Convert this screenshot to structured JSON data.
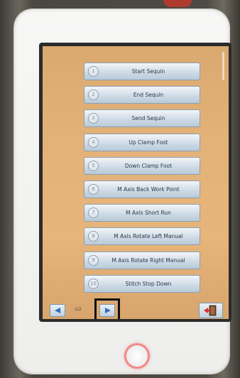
{
  "menu": {
    "items": [
      {
        "num": "1",
        "label": "Start Sequin"
      },
      {
        "num": "2",
        "label": "End Sequin"
      },
      {
        "num": "3",
        "label": "Send Sequin"
      },
      {
        "num": "4",
        "label": "Up Clamp Foot"
      },
      {
        "num": "5",
        "label": "Down Clamp Foot"
      },
      {
        "num": "6",
        "label": "M Axis Back Work Point"
      },
      {
        "num": "7",
        "label": "M Axis Short Run"
      },
      {
        "num": "8",
        "label": "M Axis Rotate Left Manual"
      },
      {
        "num": "9",
        "label": "M Axis Rotate Right Manual"
      },
      {
        "num": "10",
        "label": "Stitch Stop Down"
      }
    ]
  },
  "pager": {
    "page_indicator": "1/2",
    "prev_icon": "arrow-left-icon",
    "next_icon": "arrow-right-icon"
  },
  "exit": {
    "icon": "exit-door-icon"
  },
  "colors": {
    "screen_bg": "#e3b278",
    "button_text": "#2a3848",
    "arrow": "#2f6fb5",
    "home_ring": "#f08a8a"
  }
}
